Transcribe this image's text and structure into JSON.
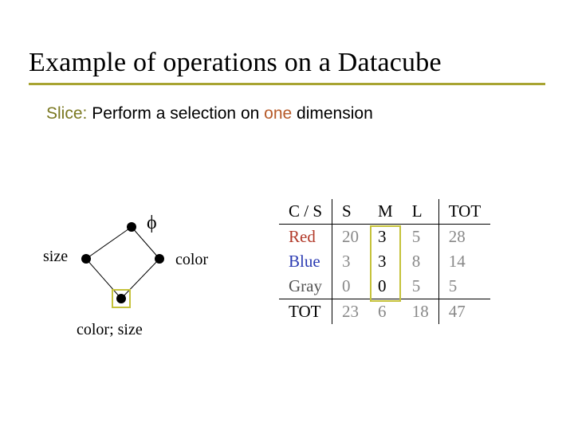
{
  "title": "Example of operations on a Datacube",
  "subtitle": {
    "slice_label": "Slice:",
    "mid_text": " Perform a selection on ",
    "one": "one",
    "tail": " dimension"
  },
  "lattice": {
    "phi": "ϕ",
    "left": "size",
    "right": "color",
    "bottom": "color; size"
  },
  "table": {
    "corner": "C / S",
    "cols": [
      "S",
      "M",
      "L"
    ],
    "tot_label": "TOT",
    "rows": [
      {
        "label": "Red",
        "cls": "red",
        "cells": [
          "20",
          "3",
          "5"
        ],
        "tot": "28"
      },
      {
        "label": "Blue",
        "cls": "blue",
        "cells": [
          "3",
          "3",
          "8"
        ],
        "tot": "14"
      },
      {
        "label": "Gray",
        "cls": "gray",
        "cells": [
          "0",
          "0",
          "5"
        ],
        "tot": "5"
      }
    ],
    "col_tots": [
      "23",
      "6",
      "18"
    ],
    "grand_tot": "47"
  },
  "chart_data": {
    "type": "table",
    "title": "Example of operations on a Datacube — Slice on one dimension",
    "row_dimension": "Color",
    "col_dimension": "Size",
    "categories_cols": [
      "S",
      "M",
      "L"
    ],
    "categories_rows": [
      "Red",
      "Blue",
      "Gray"
    ],
    "values": [
      [
        20,
        3,
        5
      ],
      [
        3,
        3,
        8
      ],
      [
        0,
        0,
        5
      ]
    ],
    "row_totals": [
      28,
      14,
      5
    ],
    "col_totals": [
      23,
      6,
      18
    ],
    "grand_total": 47,
    "highlighted_column": "M",
    "lattice": {
      "top": "phi (empty)",
      "left": "size",
      "right": "color",
      "bottom": "color; size",
      "selected_node": "bottom"
    }
  }
}
